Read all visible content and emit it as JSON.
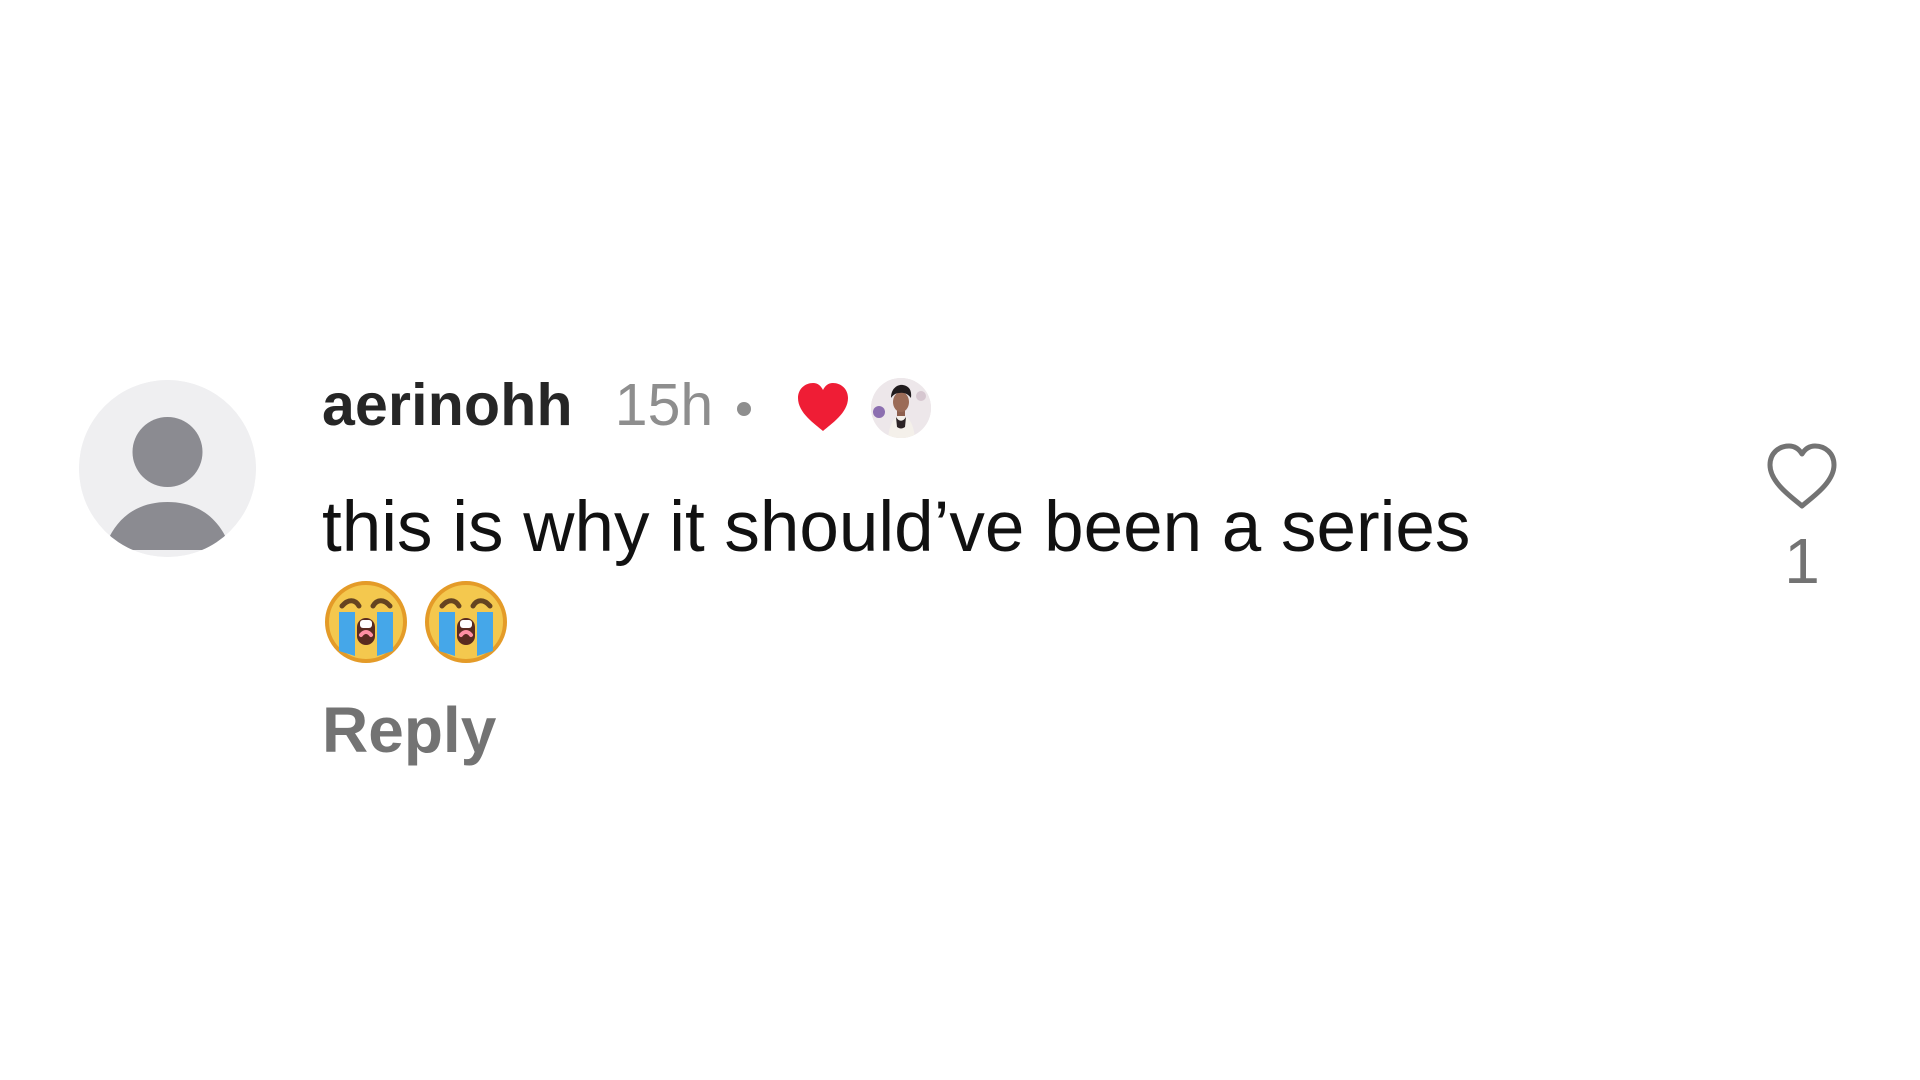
{
  "comment": {
    "username": "aerinohh",
    "time_ago": "15h",
    "separator": "•",
    "creator_liked_icon": "red-heart-icon",
    "creator_avatar_icon": "creator-avatar",
    "text": "this is why it should’ve been a series",
    "emojis": [
      "loudly-crying-face-emoji",
      "loudly-crying-face-emoji"
    ],
    "reply_label": "Reply",
    "like_icon": "heart-outline-icon",
    "like_count": "1"
  },
  "colors": {
    "username": "#262626",
    "muted": "#8e8e8e",
    "reply": "#737373",
    "heart_red": "#ef1d35",
    "avatar_bg": "#efeff1",
    "avatar_fg": "#8b8b91"
  }
}
